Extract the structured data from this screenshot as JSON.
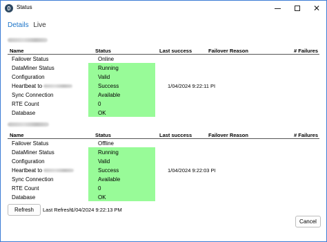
{
  "window": {
    "title": "Status"
  },
  "tabs": [
    {
      "label": "Details",
      "active": true
    },
    {
      "label": "Live",
      "active": false
    }
  ],
  "columns": {
    "name": "Name",
    "status": "Status",
    "last_success": "Last success",
    "failover_reason": "Failover Reason",
    "failures": "# Failures"
  },
  "groups": [
    {
      "rows": [
        {
          "name": "Failover Status",
          "status": "Online"
        },
        {
          "name": "DataMiner Status",
          "status": "Running"
        },
        {
          "name": "Configuration",
          "status": "Valid"
        },
        {
          "name": "Heartbeat to",
          "status": "Success"
        },
        {
          "name": "Sync Connection",
          "status": "Available"
        },
        {
          "name": "RTE Count",
          "status": "0"
        },
        {
          "name": "Database",
          "status": "OK"
        }
      ],
      "heartbeat_last_success": "1/04/2024 9:22:11 PI"
    },
    {
      "rows": [
        {
          "name": "Failover Status",
          "status": "Offline"
        },
        {
          "name": "DataMiner Status",
          "status": "Running"
        },
        {
          "name": "Configuration",
          "status": "Valid"
        },
        {
          "name": "Heartbeat to",
          "status": "Success"
        },
        {
          "name": "Sync Connection",
          "status": "Available"
        },
        {
          "name": "RTE Count",
          "status": "0"
        },
        {
          "name": "Database",
          "status": "OK"
        }
      ],
      "heartbeat_last_success": "1/04/2024 9:22:03 PI"
    }
  ],
  "footer": {
    "refresh_label": "Refresh",
    "last_refresh_label": "Last Refresh:",
    "last_refresh_value": "1/04/2024 9:22:13 PM",
    "cancel_label": "Cancel"
  },
  "colors": {
    "accent": "#1a73c8",
    "status_ok_bg": "#98fb98"
  },
  "icons": [
    "app-icon",
    "minimize-icon",
    "maximize-icon",
    "close-icon"
  ]
}
